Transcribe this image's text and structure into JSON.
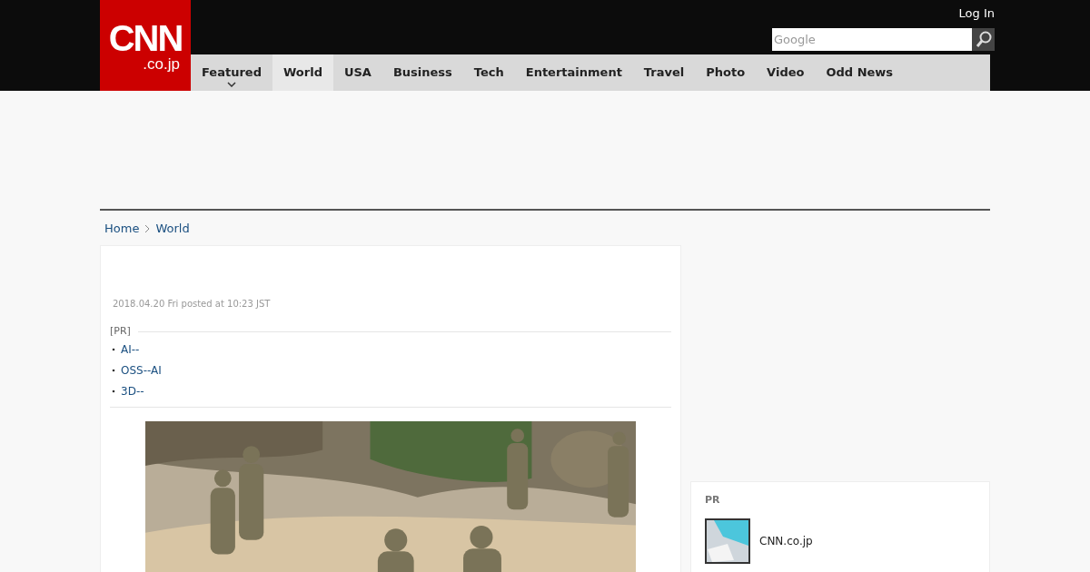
{
  "header": {
    "logo": {
      "main": "CNN",
      "sub": ".co.jp"
    },
    "login": "Log In",
    "search": {
      "placeholder": "Google"
    }
  },
  "nav": [
    {
      "label": "Featured",
      "selected": false,
      "dropdown": true
    },
    {
      "label": "World",
      "selected": true,
      "dropdown": false
    },
    {
      "label": "USA",
      "selected": false,
      "dropdown": false
    },
    {
      "label": "Business",
      "selected": false,
      "dropdown": false
    },
    {
      "label": "Tech",
      "selected": false,
      "dropdown": false
    },
    {
      "label": "Entertainment",
      "selected": false,
      "dropdown": false
    },
    {
      "label": "Travel",
      "selected": false,
      "dropdown": false
    },
    {
      "label": "Photo",
      "selected": false,
      "dropdown": false
    },
    {
      "label": "Video",
      "selected": false,
      "dropdown": false
    },
    {
      "label": "Odd News",
      "selected": false,
      "dropdown": false
    }
  ],
  "breadcrumb": [
    "Home",
    "World"
  ],
  "article": {
    "date": "2018.04.20 Fri posted at 10:23 JST",
    "pr_label": "[PR]",
    "pr_links": [
      "AI--",
      "OSS--AI",
      "3D--"
    ]
  },
  "sidebar": {
    "pr": {
      "title": "PR",
      "items": [
        {
          "label": "CNN.co.jp"
        }
      ]
    }
  }
}
